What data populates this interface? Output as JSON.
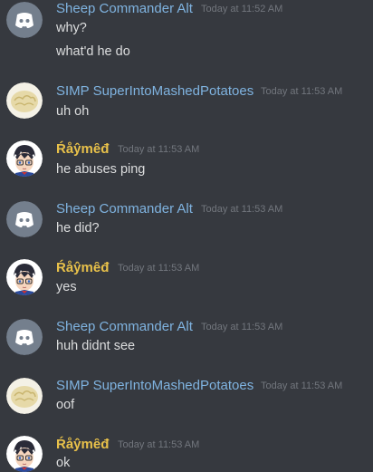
{
  "colors": {
    "background": "#36393f",
    "sheep_name": "#7fb3e0",
    "simp_name": "#7fb3e0",
    "raymed_name": "#e8c14a",
    "timestamp": "#72767d",
    "text": "#dcddde"
  },
  "messages": [
    {
      "author": "Sheep Commander Alt",
      "timestamp": "Today at 11:52 AM",
      "avatar": "discord-logo-icon",
      "lines": [
        "why?",
        "what'd he do"
      ]
    },
    {
      "author": "SIMP SuperIntoMashedPotatoes",
      "timestamp": "Today at 11:53 AM",
      "avatar": "mashed-potatoes-avatar",
      "lines": [
        "uh oh"
      ]
    },
    {
      "author": "Ŕåŷmȇđ",
      "timestamp": "Today at 11:53 AM",
      "avatar": "anime-boy-avatar",
      "lines": [
        "he abuses ping"
      ]
    },
    {
      "author": "Sheep Commander Alt",
      "timestamp": "Today at 11:53 AM",
      "avatar": "discord-logo-icon",
      "lines": [
        "he did?"
      ]
    },
    {
      "author": "Ŕåŷmȇđ",
      "timestamp": "Today at 11:53 AM",
      "avatar": "anime-boy-avatar",
      "lines": [
        "yes"
      ]
    },
    {
      "author": "Sheep Commander Alt",
      "timestamp": "Today at 11:53 AM",
      "avatar": "discord-logo-icon",
      "lines": [
        "huh didnt see"
      ]
    },
    {
      "author": "SIMP SuperIntoMashedPotatoes",
      "timestamp": "Today at 11:53 AM",
      "avatar": "mashed-potatoes-avatar",
      "lines": [
        "oof"
      ]
    },
    {
      "author": "Ŕåŷmȇđ",
      "timestamp": "Today at 11:53 AM",
      "avatar": "anime-boy-avatar",
      "lines": [
        "ok"
      ]
    }
  ]
}
